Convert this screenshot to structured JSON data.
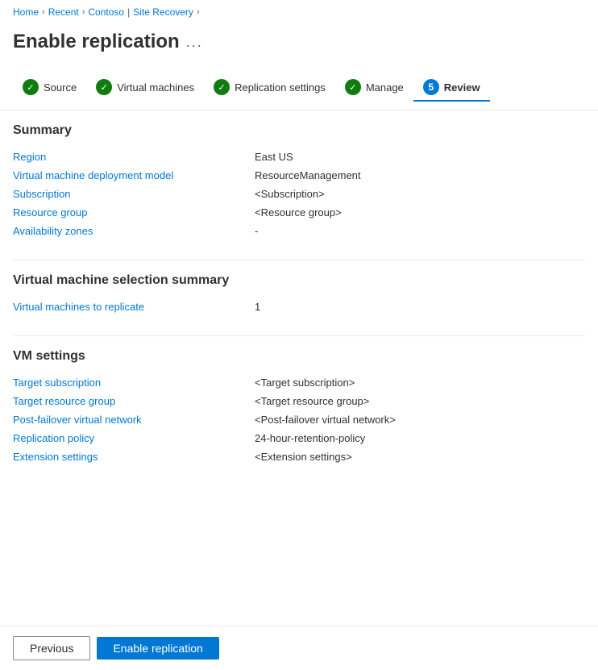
{
  "breadcrumb": {
    "home": "Home",
    "recent": "Recent",
    "contoso": "Contoso",
    "site_recovery": "Site Recovery",
    "separator": "›"
  },
  "page": {
    "title": "Enable replication",
    "dots": "..."
  },
  "steps": [
    {
      "id": "source",
      "label": "Source",
      "state": "complete"
    },
    {
      "id": "virtual-machines",
      "label": "Virtual machines",
      "state": "complete"
    },
    {
      "id": "replication-settings",
      "label": "Replication settings",
      "state": "complete"
    },
    {
      "id": "manage",
      "label": "Manage",
      "state": "complete"
    },
    {
      "id": "review",
      "label": "Review",
      "state": "active",
      "number": "5"
    }
  ],
  "summary_section": {
    "title": "Summary",
    "rows": [
      {
        "label": "Region",
        "value": "East US"
      },
      {
        "label": "Virtual machine deployment model",
        "value": "ResourceManagement"
      },
      {
        "label": "Subscription",
        "value": "<Subscription>"
      },
      {
        "label": "Resource group",
        "value": "<Resource group>"
      },
      {
        "label": "Availability zones",
        "value": "-"
      }
    ]
  },
  "vm_selection_section": {
    "title": "Virtual machine selection summary",
    "rows": [
      {
        "label": "Virtual machines to replicate",
        "value": "1"
      }
    ]
  },
  "vm_settings_section": {
    "title": "VM settings",
    "rows": [
      {
        "label": "Target subscription",
        "value": "<Target subscription>",
        "link": false
      },
      {
        "label": "Target resource group",
        "value": "<Target resource group>",
        "link": false
      },
      {
        "label": "Post-failover virtual network",
        "value": "<Post-failover virtual network>",
        "link": false
      },
      {
        "label": "Replication policy",
        "value": "24-hour-retention-policy",
        "link": true
      },
      {
        "label": "Extension settings",
        "value": "<Extension settings>",
        "link": false
      }
    ]
  },
  "footer": {
    "previous_label": "Previous",
    "enable_label": "Enable replication"
  },
  "icons": {
    "checkmark": "✓"
  }
}
